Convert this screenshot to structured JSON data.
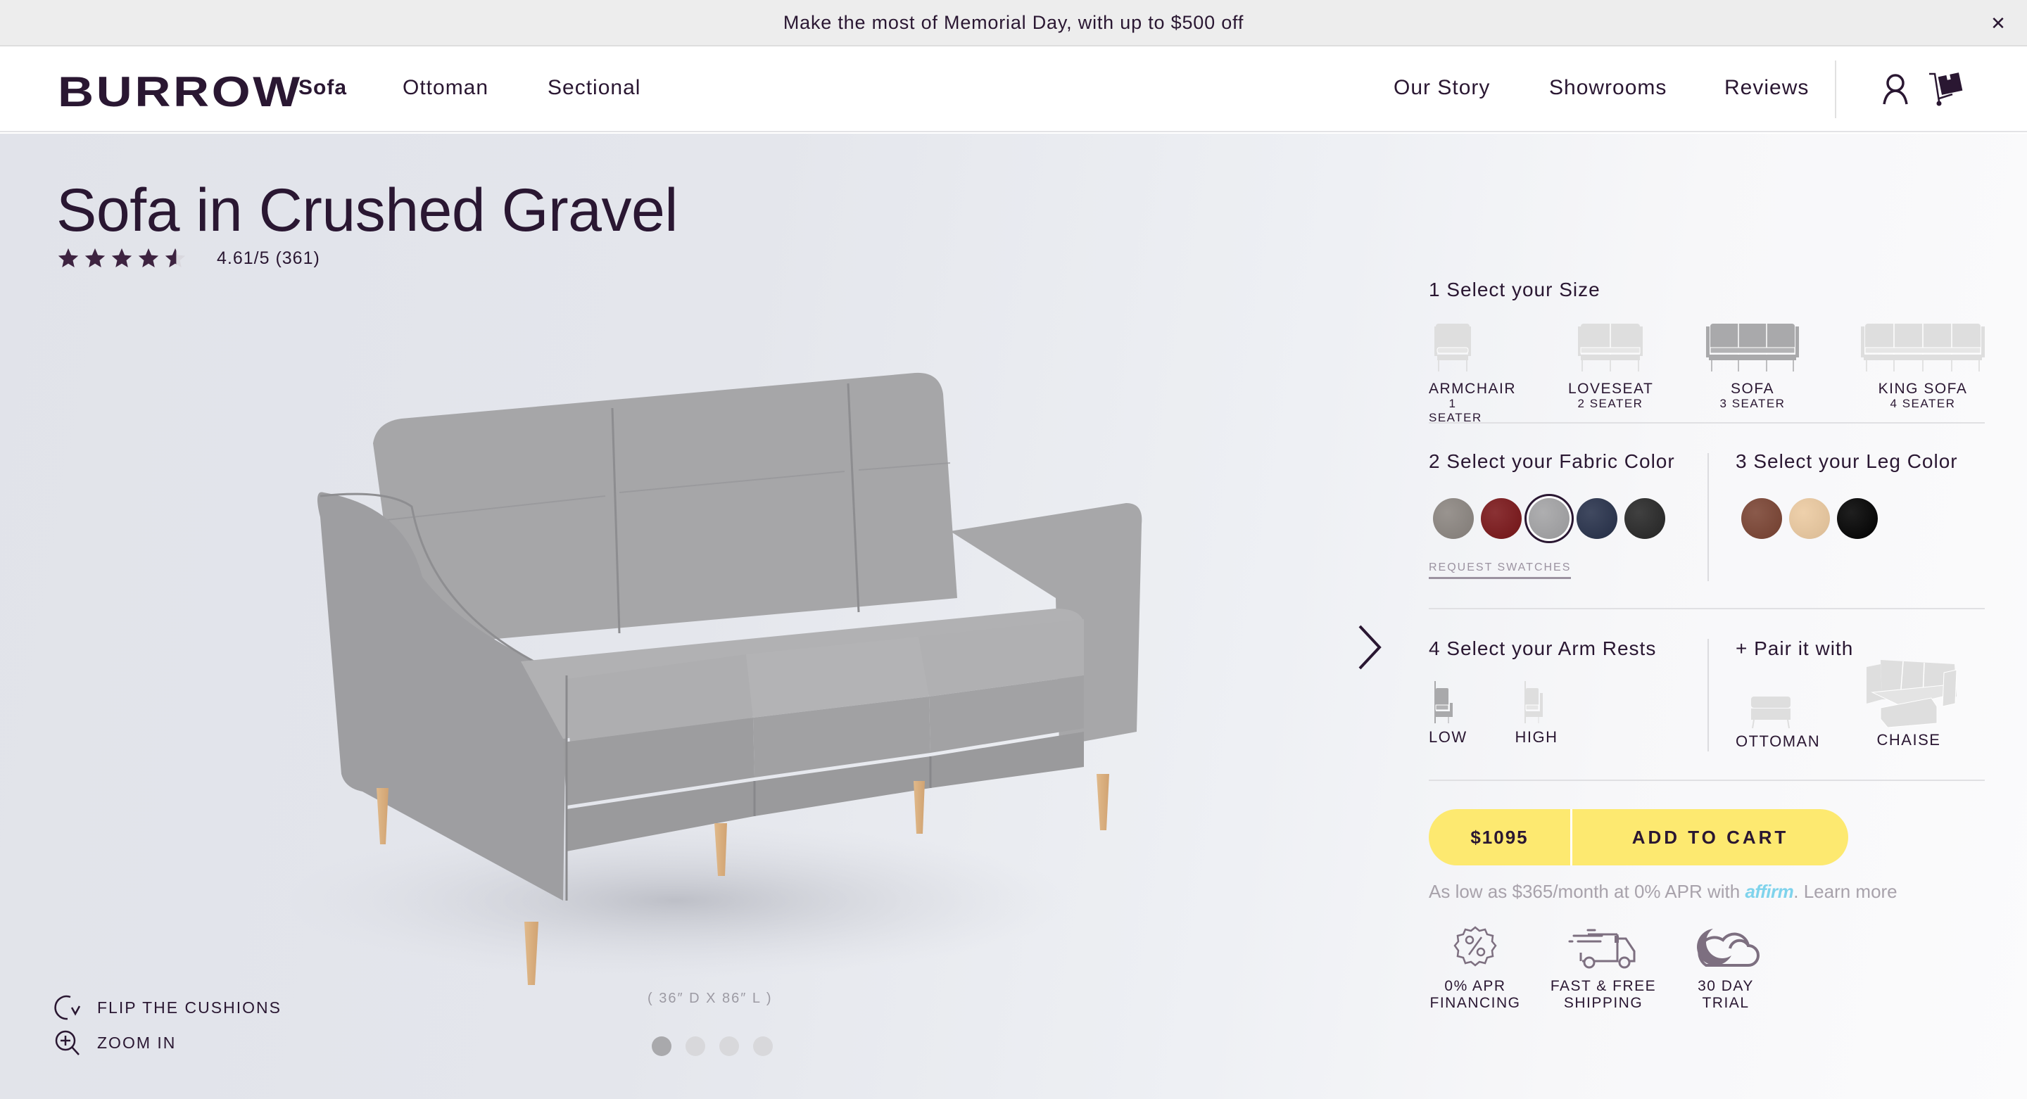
{
  "banner": {
    "text": "Make the most of Memorial Day, with up to $500 off",
    "close_icon": "close-icon"
  },
  "nav": {
    "logo": "BURROW",
    "left_links": [
      {
        "label": "Sofa",
        "active": true
      },
      {
        "label": "Ottoman",
        "active": false
      },
      {
        "label": "Sectional",
        "active": false
      }
    ],
    "right_links": [
      {
        "label": "Our Story"
      },
      {
        "label": "Showrooms"
      },
      {
        "label": "Reviews"
      }
    ],
    "icons": [
      "account-icon",
      "cart-icon"
    ]
  },
  "product": {
    "title": "Sofa in Crushed Gravel",
    "rating_value": 4.61,
    "rating_max": 5,
    "rating_text": "4.61/5 (361)",
    "review_count": 361,
    "dimensions": "( 36″ D X 86″ L )",
    "gallery_pages": 4,
    "gallery_active_index": 0
  },
  "tools": {
    "flip": "FLIP THE CUSHIONS",
    "zoom": "ZOOM IN"
  },
  "configurator": {
    "size": {
      "heading": "1 Select your Size",
      "options": [
        {
          "name": "ARMCHAIR",
          "sub": "1 SEATER",
          "seats": 1,
          "selected": false
        },
        {
          "name": "LOVESEAT",
          "sub": "2 SEATER",
          "seats": 2,
          "selected": false
        },
        {
          "name": "SOFA",
          "sub": "3 SEATER",
          "seats": 3,
          "selected": true
        },
        {
          "name": "KING SOFA",
          "sub": "4 SEATER",
          "seats": 4,
          "selected": false
        }
      ]
    },
    "fabric": {
      "heading": "2 Select your Fabric Color",
      "swatches": [
        {
          "name": "taupe",
          "color": "#8b8580",
          "selected": false
        },
        {
          "name": "red",
          "color": "#7a1518",
          "selected": false
        },
        {
          "name": "crushed-gravel",
          "color": "#a3a3a5",
          "selected": true
        },
        {
          "name": "navy",
          "color": "#26304a",
          "selected": false
        },
        {
          "name": "black",
          "color": "#262626",
          "selected": false
        }
      ],
      "request_link": "REQUEST SWATCHES"
    },
    "legs": {
      "heading": "3 Select your Leg Color",
      "swatches": [
        {
          "name": "walnut",
          "color": "#7a4332",
          "selected": false
        },
        {
          "name": "natural",
          "color": "#eccaa0",
          "selected": false
        },
        {
          "name": "black",
          "color": "#000000",
          "selected": false
        }
      ]
    },
    "arms": {
      "heading": "4 Select your Arm Rests",
      "options": [
        {
          "label": "LOW",
          "selected": true
        },
        {
          "label": "HIGH",
          "selected": false
        }
      ]
    },
    "pair": {
      "heading": "+ Pair it with",
      "options": [
        {
          "label": "OTTOMAN"
        },
        {
          "label": "CHAISE"
        }
      ]
    },
    "cart": {
      "price": "$1095",
      "add_label": "ADD TO CART",
      "accent": "#fde970"
    },
    "financing": {
      "prefix": "As low as $365/month at 0% APR with ",
      "brand": "affirm",
      "suffix": ". ",
      "learn_more": "Learn more"
    },
    "perks": [
      {
        "line1": "0% APR",
        "line2": "FINANCING",
        "icon": "percent-badge-icon"
      },
      {
        "line1": "FAST & FREE",
        "line2": "SHIPPING",
        "icon": "truck-icon"
      },
      {
        "line1": "30 DAY",
        "line2": "TRIAL",
        "icon": "moon-cloud-icon"
      }
    ]
  },
  "colors": {
    "text": "#2a1732",
    "muted": "#a8a2ab",
    "affirm": "#7fd3ec",
    "icon_gray": "#7d6f80"
  }
}
